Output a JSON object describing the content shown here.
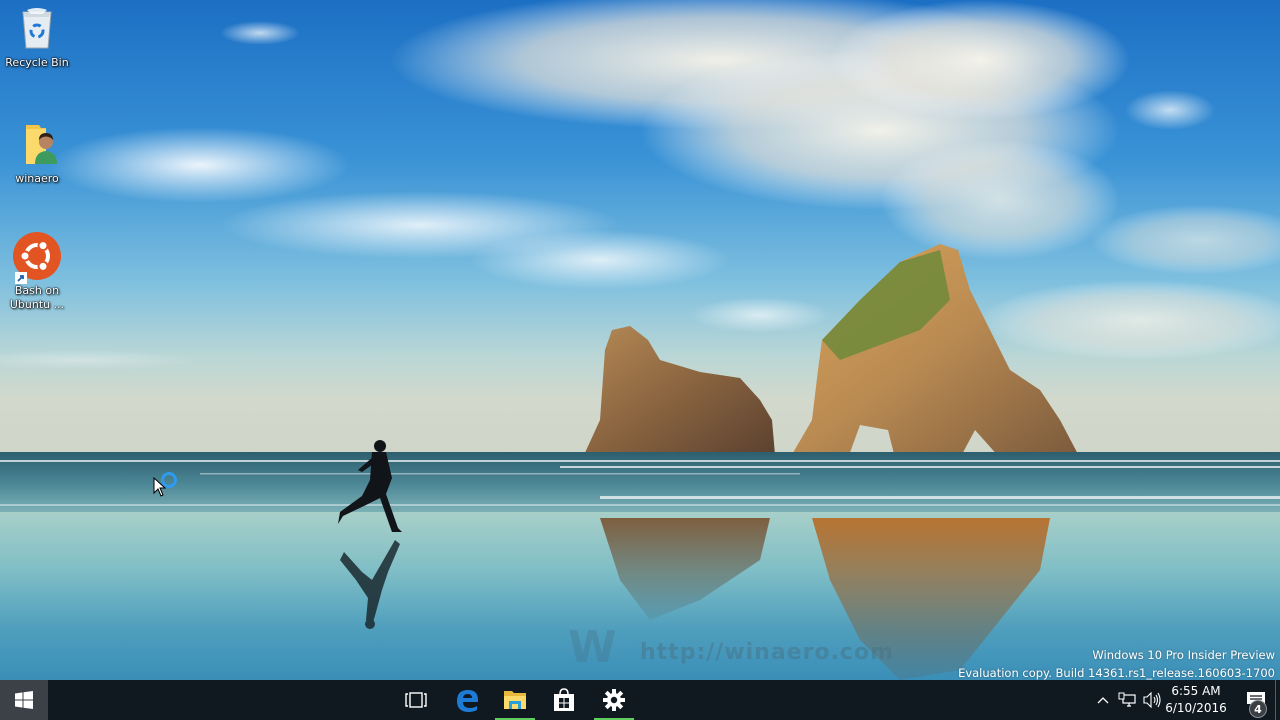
{
  "desktop": {
    "icons": [
      {
        "label": "Recycle Bin",
        "icon": "recycle-bin-icon"
      },
      {
        "label": "winaero",
        "icon": "user-folder-icon"
      },
      {
        "label": "Bash on Ubuntu ...",
        "label_line1": "Bash on",
        "label_line2": "Ubuntu ...",
        "icon": "ubuntu-icon",
        "shortcut": true
      }
    ],
    "watermark": {
      "line1": "Windows 10 Pro Insider Preview",
      "line2": "Evaluation copy. Build 14361.rs1_release.160603-1700"
    },
    "site_watermark": {
      "letter": "W",
      "url": "http://winaero.com"
    },
    "cursor": {
      "state": "working-in-background",
      "icon": "busy-cursor-icon"
    }
  },
  "taskbar": {
    "start": {
      "icon": "windows-logo-icon",
      "label": "Start"
    },
    "pinned": [
      {
        "name": "Task View",
        "icon": "task-view-icon",
        "active": false
      },
      {
        "name": "Microsoft Edge",
        "icon": "edge-icon",
        "active": false
      },
      {
        "name": "File Explorer",
        "icon": "folder-icon",
        "active": true
      },
      {
        "name": "Store",
        "icon": "store-icon",
        "active": false
      },
      {
        "name": "Settings",
        "icon": "gear-icon",
        "active": true
      }
    ],
    "tray": {
      "chevron": "chevron-up-icon",
      "network": "network-icon",
      "volume": "volume-icon",
      "time": "6:55 AM",
      "date": "6/10/2016",
      "action_center": {
        "icon": "action-center-icon",
        "badge": "4"
      }
    },
    "colors": {
      "background": "#101820",
      "start_bg": "#3b4146",
      "active_indicator": "#5fce5f",
      "edge_blue": "#1d7bd6"
    }
  }
}
